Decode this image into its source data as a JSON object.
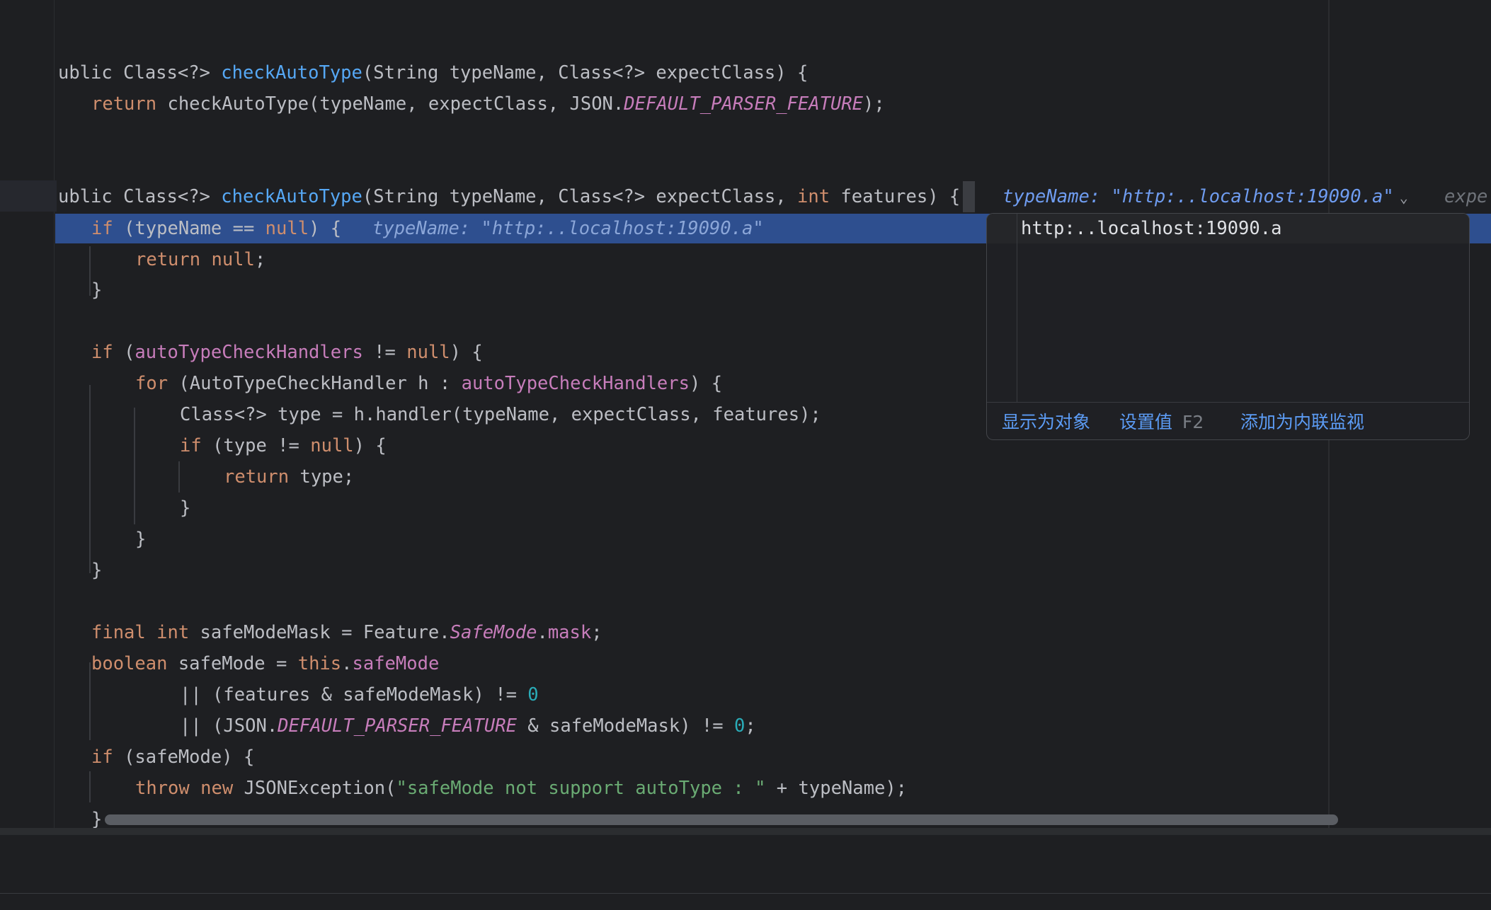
{
  "editor": {
    "lines": [
      [
        [
          "",
          "ublic "
        ],
        [
          "",
          "Class<?> "
        ],
        [
          "fn",
          "checkAutoType"
        ],
        [
          "",
          "(String typeName, Class<?> expectClass) {"
        ]
      ],
      [
        [
          "kw",
          "return "
        ],
        [
          "",
          "checkAutoType(typeName, expectClass, JSON."
        ],
        [
          "st",
          "DEFAULT_PARSER_FEATURE"
        ],
        [
          "",
          ");"
        ]
      ],
      [
        [
          "",
          "ublic "
        ],
        [
          "",
          "Class<?> "
        ],
        [
          "fn",
          "checkAutoType"
        ],
        [
          "",
          "(String typeName, Class<?> expectClass, "
        ],
        [
          "kw",
          "int "
        ],
        [
          "",
          "features) {"
        ]
      ],
      [
        [
          "kw",
          "if "
        ],
        [
          "",
          "(typeName == "
        ],
        [
          "kw",
          "null"
        ],
        [
          "",
          ") {"
        ]
      ],
      [
        [
          "kw",
          "return "
        ],
        [
          "kw",
          "null"
        ],
        [
          "",
          ";"
        ]
      ],
      [
        [
          "",
          "}"
        ]
      ],
      [
        [
          "kw",
          "if "
        ],
        [
          "",
          "("
        ],
        [
          "fld",
          "autoTypeCheckHandlers"
        ],
        [
          "",
          " != "
        ],
        [
          "kw",
          "null"
        ],
        [
          "",
          ") {"
        ]
      ],
      [
        [
          "kw",
          "for "
        ],
        [
          "",
          "(AutoTypeCheckHandler h : "
        ],
        [
          "fld",
          "autoTypeCheckHandlers"
        ],
        [
          "",
          ") {"
        ]
      ],
      [
        [
          "",
          "Class<?> type = h.handler(typeName, expectClass, features);"
        ]
      ],
      [
        [
          "kw",
          "if "
        ],
        [
          "",
          "(type != "
        ],
        [
          "kw",
          "null"
        ],
        [
          "",
          ") {"
        ]
      ],
      [
        [
          "kw",
          "return "
        ],
        [
          "",
          "type;"
        ]
      ],
      [
        [
          "",
          "}"
        ]
      ],
      [
        [
          "",
          "}"
        ]
      ],
      [
        [
          "",
          "}"
        ]
      ],
      [
        [
          "kw",
          "final int "
        ],
        [
          "",
          "safeModeMask = Feature."
        ],
        [
          "st",
          "SafeMode"
        ],
        [
          "",
          "."
        ],
        [
          "fld",
          "mask"
        ],
        [
          "",
          ";"
        ]
      ],
      [
        [
          "kw",
          "boolean "
        ],
        [
          "",
          "safeMode = "
        ],
        [
          "kw",
          "this"
        ],
        [
          "",
          "."
        ],
        [
          "fld",
          "safeMode"
        ]
      ],
      [
        [
          "",
          "|| (features & safeModeMask) != "
        ],
        [
          "num",
          "0"
        ]
      ],
      [
        [
          "",
          "|| (JSON."
        ],
        [
          "st",
          "DEFAULT_PARSER_FEATURE"
        ],
        [
          "",
          " & safeModeMask) != "
        ],
        [
          "num",
          "0"
        ],
        [
          "",
          ";"
        ]
      ],
      [
        [
          "kw",
          "if "
        ],
        [
          "",
          "(safeMode) {"
        ]
      ],
      [
        [
          "kw",
          "throw new "
        ],
        [
          "",
          "JSONException("
        ],
        [
          "str",
          "\"safeMode not support autoType : \""
        ],
        [
          "",
          " + typeName);"
        ]
      ],
      [
        [
          "",
          "}"
        ]
      ]
    ]
  },
  "hints": {
    "signature_hint": "typeName: \"http:..localhost:19090.a\"",
    "signature_hint_next": "expe",
    "exec_line_hint": "typeName: \"http:..localhost:19090.a\"",
    "chevron_icon": "chevron-down-icon"
  },
  "popup": {
    "value": "http:..localhost:19090.a",
    "show_as_object": "显示为对象",
    "set_value": "设置值",
    "set_value_shortcut": "F2",
    "add_inline_watch": "添加为内联监视"
  },
  "colors": {
    "background": "#1e1f22",
    "keyword": "#cf8e6d",
    "function": "#56a8f5",
    "field": "#c77dbb",
    "number": "#2aacb8",
    "string": "#6aab73",
    "execution_line": "#2e4f8f",
    "link": "#5c9cf5"
  }
}
